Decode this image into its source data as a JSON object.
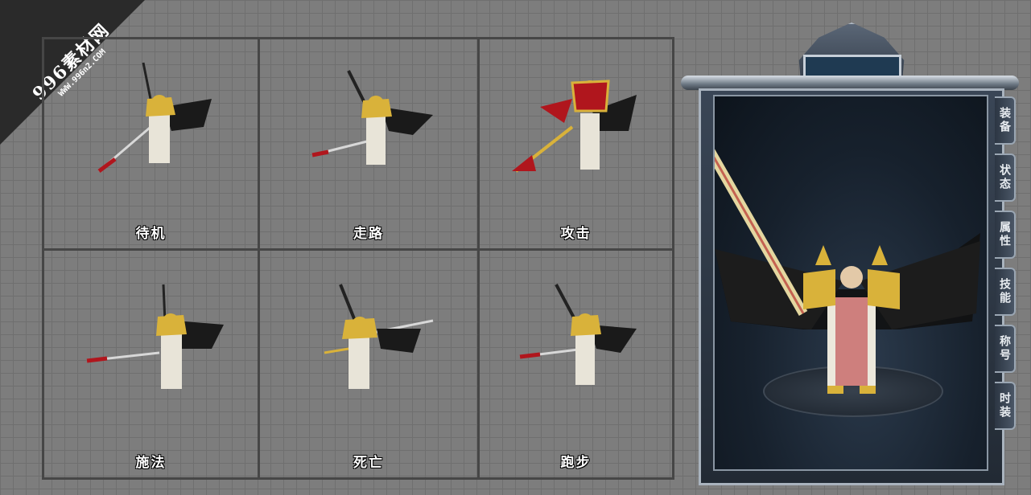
{
  "watermark": {
    "main": "996素材网",
    "sub": "WWW.996n2.COM"
  },
  "frames": [
    {
      "label": "待机",
      "sprite": "warrior-idle-icon"
    },
    {
      "label": "走路",
      "sprite": "warrior-walk-icon"
    },
    {
      "label": "攻击",
      "sprite": "warrior-attack-icon"
    },
    {
      "label": "施法",
      "sprite": "warrior-cast-icon"
    },
    {
      "label": "死亡",
      "sprite": "warrior-death-icon"
    },
    {
      "label": "跑步",
      "sprite": "warrior-run-icon"
    }
  ],
  "panel": {
    "tabs": [
      "装备",
      "状态",
      "属性",
      "技能",
      "称号",
      "时装"
    ]
  },
  "colors": {
    "gold": "#d9b23a",
    "crimson": "#b0161d",
    "wing": "#1a1a1a"
  }
}
